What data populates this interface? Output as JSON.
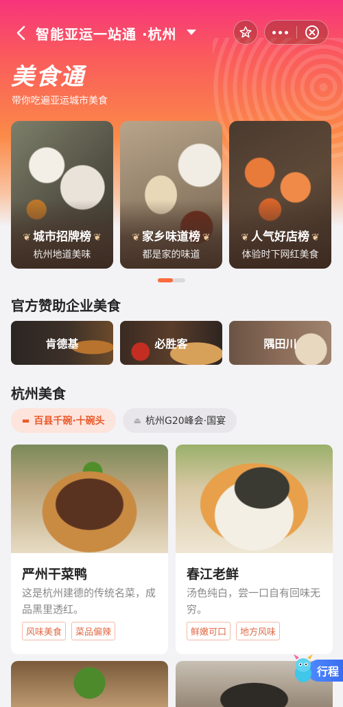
{
  "header": {
    "title": "智能亚运一站通 ·杭州",
    "brand": "美食通",
    "subtitle": "带你吃遍亚运城市美食"
  },
  "cards": [
    {
      "title": "城市招牌榜",
      "subtitle": "杭州地道美味"
    },
    {
      "title": "家乡味道榜",
      "subtitle": "都是家的味道"
    },
    {
      "title": "人气好店榜",
      "subtitle": "体验时下网红美食"
    }
  ],
  "sponsors": {
    "heading": "官方赞助企业美食",
    "items": [
      {
        "label": "肯德基"
      },
      {
        "label": "必胜客"
      },
      {
        "label": "隅田川"
      }
    ]
  },
  "hangzhou": {
    "heading": "杭州美食",
    "chips": [
      {
        "label": "百县千碗·十碗头",
        "active": true
      },
      {
        "label": "杭州G20峰会·国宴",
        "active": false
      }
    ],
    "foods": [
      {
        "name": "严州干菜鸭",
        "desc": "这是杭州建德的传统名菜，成品黑里透红。",
        "tags": [
          "风味美食",
          "菜品偏辣"
        ]
      },
      {
        "name": "春江老鲜",
        "desc": "汤色纯白，尝一口自有回味无穷。",
        "tags": [
          "鲜嫩可口",
          "地方风味"
        ]
      }
    ]
  },
  "float": {
    "label": "行程"
  },
  "colors": {
    "accent": "#fa6a3a",
    "brand_gradient_top": "#f7347b",
    "tag": "#e06a45"
  }
}
